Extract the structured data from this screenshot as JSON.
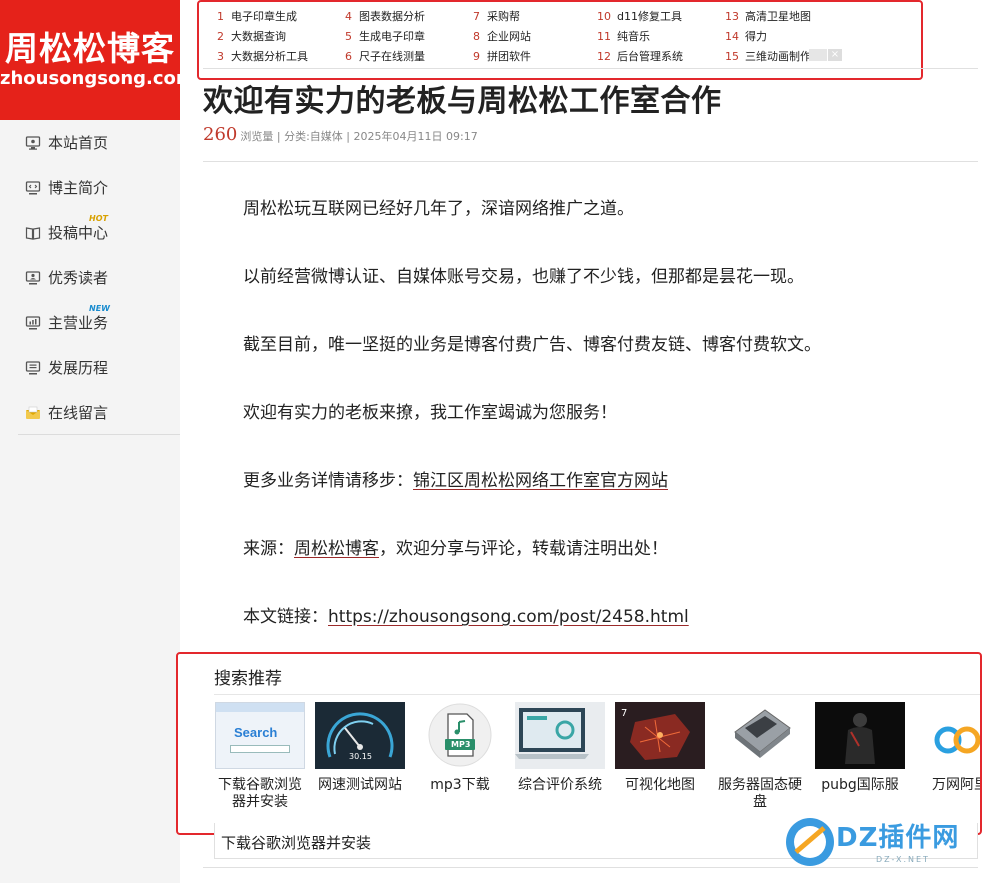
{
  "site": {
    "logo_cn": "周松松博客",
    "logo_en": "zhousongsong.com"
  },
  "sidebar": {
    "items": [
      {
        "label": "本站首页",
        "icon": "monitor-icon",
        "badge": ""
      },
      {
        "label": "博主简介",
        "icon": "monitor-code-icon",
        "badge": ""
      },
      {
        "label": "投稿中心",
        "icon": "book-icon",
        "badge": "HOT"
      },
      {
        "label": "优秀读者",
        "icon": "monitor-user-icon",
        "badge": ""
      },
      {
        "label": "主营业务",
        "icon": "monitor-chart-icon",
        "badge": "NEW"
      },
      {
        "label": "发展历程",
        "icon": "monitor-list-icon",
        "badge": ""
      },
      {
        "label": "在线留言",
        "icon": "envelope-icon",
        "badge": ""
      }
    ]
  },
  "top_links": [
    {
      "n": "1",
      "label": "电子印章生成"
    },
    {
      "n": "2",
      "label": "大数据查询"
    },
    {
      "n": "3",
      "label": "大数据分析工具"
    },
    {
      "n": "4",
      "label": "图表数据分析"
    },
    {
      "n": "5",
      "label": "生成电子印章"
    },
    {
      "n": "6",
      "label": "尺子在线测量"
    },
    {
      "n": "7",
      "label": "采购帮"
    },
    {
      "n": "8",
      "label": "企业网站"
    },
    {
      "n": "9",
      "label": "拼团软件"
    },
    {
      "n": "10",
      "label": "d11修复工具"
    },
    {
      "n": "11",
      "label": "纯音乐"
    },
    {
      "n": "12",
      "label": "后台管理系统"
    },
    {
      "n": "13",
      "label": "高清卫星地图"
    },
    {
      "n": "14",
      "label": "得力"
    },
    {
      "n": "15",
      "label": "三维动画制作"
    }
  ],
  "close_glyph": "×",
  "article": {
    "title": "欢迎有实力的老板与周松松工作室合作",
    "views": "260",
    "views_label": "浏览量",
    "separator": "|",
    "category": "分类:自媒体",
    "date": "2025年04月11日 09:17",
    "p1": "周松松玩互联网已经好几年了，深谙网络推广之道。",
    "p2": "以前经营微博认证、自媒体账号交易，也赚了不少钱，但那都是昙花一现。",
    "p3": "截至目前，唯一坚挺的业务是博客付费广告、博客付费友链、博客付费软文。",
    "p4": "欢迎有实力的老板来撩，我工作室竭诚为您服务！",
    "p5_prefix": "更多业务详情请移步：",
    "p5_link": "锦江区周松松网络工作室官方网站",
    "p6_prefix": "来源：",
    "p6_link": "周松松博客",
    "p6_suffix": "，欢迎分享与评论，转载请注明出处！",
    "p7_prefix": "本文链接：",
    "p7_link": "https://zhousongsong.com/post/2458.html"
  },
  "recommend": {
    "title": "搜索推荐",
    "items": [
      {
        "label": "下载谷歌浏览器并安装",
        "thumb_text": "Search"
      },
      {
        "label": "网速测试网站",
        "thumb_text": "30.15"
      },
      {
        "label": "mp3下载",
        "thumb_text": "MP3"
      },
      {
        "label": "综合评价系统",
        "thumb_text": ""
      },
      {
        "label": "可视化地图",
        "thumb_text": "7"
      },
      {
        "label": "服务器固态硬盘",
        "thumb_text": ""
      },
      {
        "label": "pubg国际服",
        "thumb_text": ""
      },
      {
        "label": "万网阿里",
        "thumb_text": ""
      }
    ],
    "bottom_text": "下载谷歌浏览器并安装"
  },
  "watermark": {
    "text": "DZ插件网",
    "sub": "DZ-X.NET"
  },
  "colors": {
    "brand_red": "#e5221a",
    "highlight_border": "#e3282d",
    "accent": "#c0392b",
    "watermark_blue": "#3a9be0"
  }
}
